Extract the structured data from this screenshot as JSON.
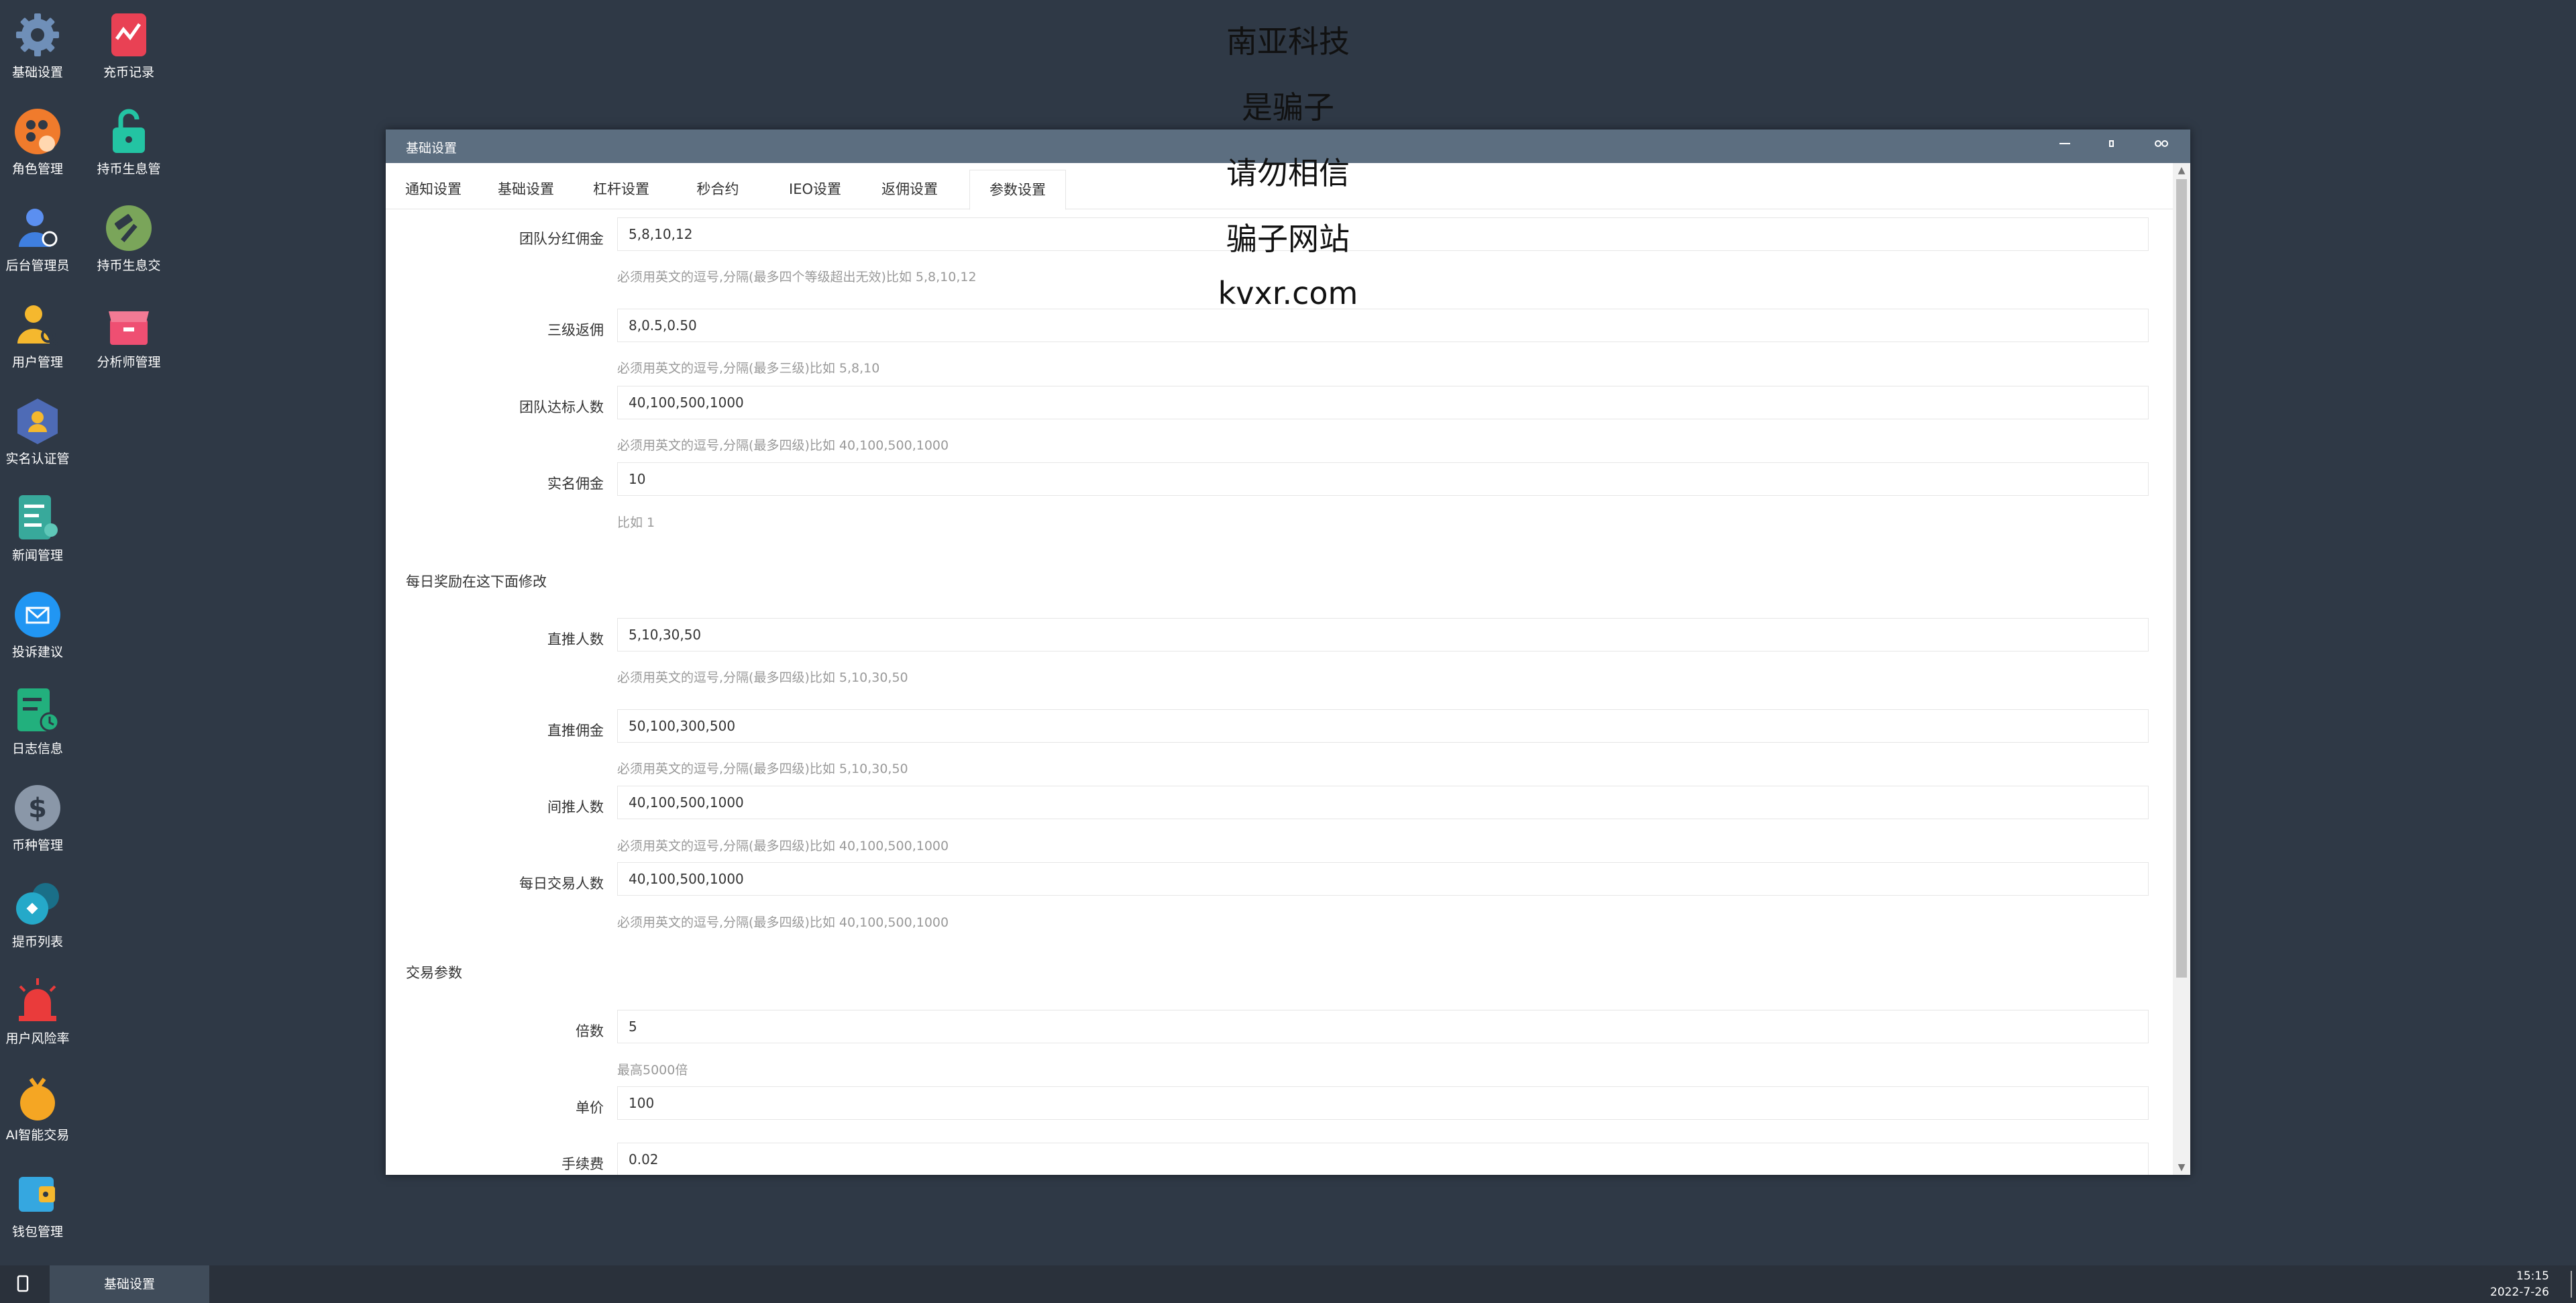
{
  "watermark": [
    "南亚科技",
    "是骗子",
    "请勿相信",
    "骗子网站",
    "kvxr.com"
  ],
  "desktop_left": [
    {
      "label": "基础设置",
      "icon": "gear-icon",
      "color": "#4a7bd0"
    },
    {
      "label": "角色管理",
      "icon": "film-roles-icon",
      "color": "#f07b2c"
    },
    {
      "label": "后台管理员",
      "icon": "admin-user-icon",
      "color": "#3f7fe0"
    },
    {
      "label": "用户管理",
      "icon": "user-search-icon",
      "color": "#f5b82e"
    },
    {
      "label": "实名认证管",
      "icon": "verify-badge-icon",
      "color": "#4e6bb6"
    },
    {
      "label": "新闻管理",
      "icon": "news-doc-icon",
      "color": "#38a99b"
    },
    {
      "label": "投诉建议",
      "icon": "mail-icon",
      "color": "#2196f3"
    },
    {
      "label": "日志信息",
      "icon": "log-clock-icon",
      "color": "#22b07d"
    },
    {
      "label": "币种管理",
      "icon": "dollar-icon",
      "color": "#8a97a8"
    },
    {
      "label": "提币列表",
      "icon": "withdraw-list-icon",
      "color": "#25a9c9"
    },
    {
      "label": "用户风险率",
      "icon": "alarm-icon",
      "color": "#ea3b3b"
    },
    {
      "label": "AI智能交易",
      "icon": "ai-money-bag-icon",
      "color": "#f5a623"
    },
    {
      "label": "钱包管理",
      "icon": "wallet-icon",
      "color": "#35a7e0"
    }
  ],
  "desktop_right": [
    {
      "label": "充币记录",
      "icon": "chart-tablet-icon",
      "color": "#e94154"
    },
    {
      "label": "持币生息管",
      "icon": "unlock-icon",
      "color": "#23c4a3"
    },
    {
      "label": "持币生息交",
      "icon": "hammer-icon",
      "color": "#7aa55a"
    },
    {
      "label": "分析师管理",
      "icon": "store-icon",
      "color": "#ef4f72"
    }
  ],
  "window": {
    "title": "基础设置",
    "tabs": [
      "通知设置",
      "基础设置",
      "杠杆设置",
      "秒合约",
      "IEO设置",
      "返佣设置",
      "参数设置"
    ],
    "active_tab": 6
  },
  "form": {
    "team_dividend": {
      "label": "团队分红佣金",
      "value": "5,8,10,12",
      "help": "必须用英文的逗号,分隔(最多四个等级超出无效)比如 5,8,10,12"
    },
    "three_level": {
      "label": "三级返佣",
      "value": "8,0.5,0.50",
      "help": "必须用英文的逗号,分隔(最多三级)比如 5,8,10"
    },
    "team_target": {
      "label": "团队达标人数",
      "value": "40,100,500,1000",
      "help": "必须用英文的逗号,分隔(最多四级)比如 40,100,500,1000"
    },
    "realname_reward": {
      "label": "实名佣金",
      "value": "10",
      "help": "比如 1"
    },
    "daily_section": "每日奖励在这下面修改",
    "direct_count": {
      "label": "直推人数",
      "value": "5,10,30,50",
      "help": "必须用英文的逗号,分隔(最多四级)比如 5,10,30,50"
    },
    "direct_reward": {
      "label": "直推佣金",
      "value": "50,100,300,500",
      "help": "必须用英文的逗号,分隔(最多四级)比如 5,10,30,50"
    },
    "indirect_count": {
      "label": "间推人数",
      "value": "40,100,500,1000",
      "help": "必须用英文的逗号,分隔(最多四级)比如 40,100,500,1000"
    },
    "daily_trade_count": {
      "label": "每日交易人数",
      "value": "40,100,500,1000",
      "help": "必须用英文的逗号,分隔(最多四级)比如 40,100,500,1000"
    },
    "trade_section": "交易参数",
    "multiple": {
      "label": "倍数",
      "value": "5",
      "help": "最高5000倍"
    },
    "unit_price": {
      "label": "单价",
      "value": "100"
    },
    "fee": {
      "label": "手续费",
      "value": "0.02"
    }
  },
  "taskbar": {
    "task_label": "基础设置",
    "time": "15:15",
    "date": "2022-7-26"
  }
}
